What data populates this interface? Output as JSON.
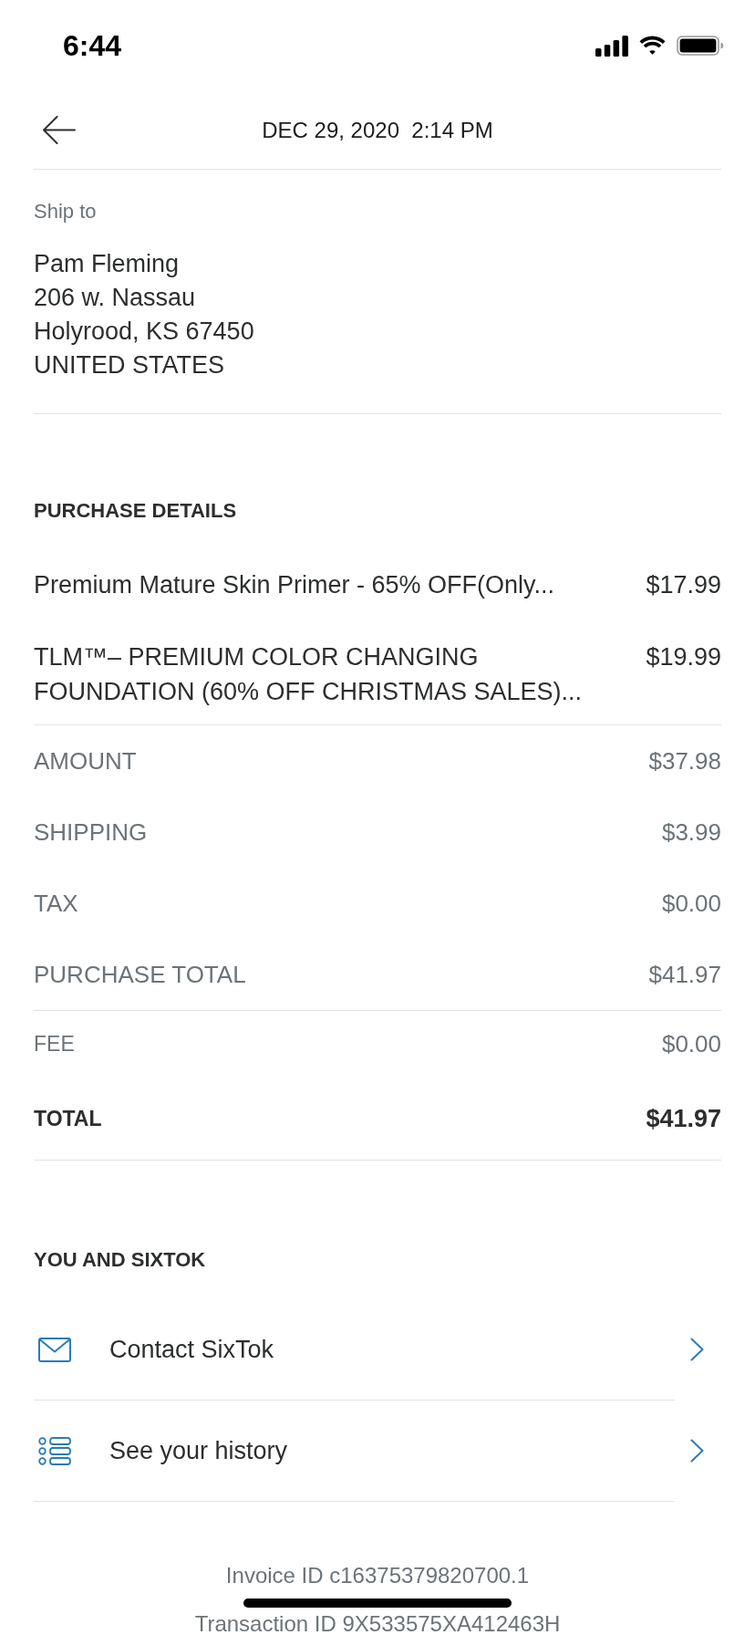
{
  "status_bar": {
    "time": "6:44"
  },
  "header": {
    "title": "DEC 29, 2020  2:14 PM"
  },
  "ship_to": {
    "label": "Ship to",
    "address_lines": [
      "Pam Fleming",
      "206 w. Nassau",
      "Holyrood, KS 67450",
      "UNITED STATES"
    ]
  },
  "purchase_details": {
    "heading": "PURCHASE DETAILS",
    "items": [
      {
        "name": "Premium Mature Skin Primer - 65% OFF(Only...",
        "price": "$17.99"
      },
      {
        "name": "TLM™– PREMIUM COLOR CHANGING FOUNDATION (60% OFF CHRISTMAS SALES)...",
        "price": "$19.99"
      }
    ]
  },
  "summary": {
    "rows": [
      {
        "kind": "line",
        "label": "AMOUNT",
        "value": "$37.98"
      },
      {
        "kind": "line",
        "label": "SHIPPING",
        "value": "$3.99"
      },
      {
        "kind": "line",
        "label": "TAX",
        "value": "$0.00"
      },
      {
        "kind": "line",
        "label": "PURCHASE TOTAL",
        "value": "$41.97"
      },
      {
        "kind": "fee",
        "label": "FEE",
        "value": "$0.00"
      },
      {
        "kind": "total",
        "label": "TOTAL",
        "value": "$41.97"
      }
    ]
  },
  "you_and_sixtok": {
    "heading": "YOU AND SIXTOK",
    "links": [
      {
        "kind": "contact",
        "label": "Contact SixTok"
      },
      {
        "kind": "history",
        "label": "See your history"
      }
    ]
  },
  "footer": {
    "invoice_id": "Invoice ID c16375379820700.1",
    "transaction_id": "Transaction ID 9X533575XA412463H"
  }
}
